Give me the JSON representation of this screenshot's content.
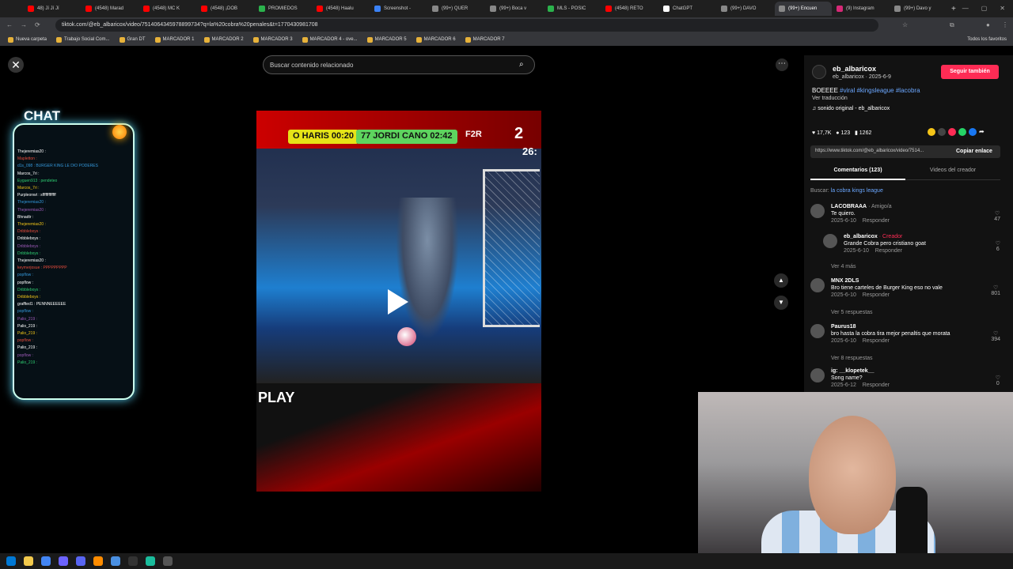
{
  "browser": {
    "tabs": [
      {
        "label": "48) Jí Jí Jí",
        "color": "#ff0000"
      },
      {
        "label": "(4548) Marad",
        "color": "#ff0000"
      },
      {
        "label": "(4548) MC K",
        "color": "#ff0000"
      },
      {
        "label": "(4548) ¡DOB",
        "color": "#ff0000"
      },
      {
        "label": "PROMIEDOS",
        "color": "#2bb24c"
      },
      {
        "label": "(4548) Haalu",
        "color": "#ff0000"
      },
      {
        "label": "Screenshot -",
        "color": "#3b82f6"
      },
      {
        "label": "(99+) QUER",
        "color": "#888888"
      },
      {
        "label": "(99+) Boca v",
        "color": "#888888"
      },
      {
        "label": "MLS - POSIC",
        "color": "#2bb24c"
      },
      {
        "label": "(4548) RETO",
        "color": "#ff0000"
      },
      {
        "label": "ChatGPT",
        "color": "#ffffff"
      },
      {
        "label": "(99+) DAVO",
        "color": "#888888"
      },
      {
        "label": "(99+) Encuen",
        "color": "#888888",
        "active": true
      },
      {
        "label": "(9) Instagram",
        "color": "#d62976"
      },
      {
        "label": "(99+) Davo y",
        "color": "#888888"
      }
    ],
    "new_tab": "+",
    "url": "tiktok.com/@eb_albaricox/video/7514064345978899734?q=la%20cobra%20penales&t=1770430981708",
    "bookmarks": [
      "Nueva carpeta",
      "Trabajo Social Com...",
      "Gran DT",
      "MARCADOR 1",
      "MARCADOR 2",
      "MARCADOR 3",
      "MARCADOR 4 - ove...",
      "MARCADOR 5",
      "MARCADOR 6",
      "MARCADOR 7"
    ],
    "all_favorites": "Todos los favoritos"
  },
  "search": {
    "placeholder": "Buscar contenido relacionado"
  },
  "video": {
    "score_left": "O HARIS 00:20",
    "score_mid": "77 JORDI CANO 02:42",
    "team": "F2R",
    "score_num": "2",
    "timer": "26:",
    "play_text": "PLAY"
  },
  "overlay_chat": {
    "title": "CHAT",
    "lines": [
      "Thejeremias20 :",
      "Mapletton :",
      "d1s_098 : BURGER KING LE DIO PODERES",
      "Marcos_7ri :",
      "Eyguen913 : pendeteo",
      "Marcos_7ri :",
      "Purpleonwt : sfffffffffffff",
      "Thejeremias20 :",
      "Thejeremias20 :",
      "Bhnadtr :",
      "Thejeremias20 :",
      "Dribbleboys :",
      "Dribbleboys :",
      "Dribbleboys :",
      "Dribbleboys :",
      "Thejeremias20 :",
      "keymerjosue : PPPPPPPPP",
      "popflow :",
      "popflow :",
      "Dribbleboys :",
      "Dribbleboys :",
      "graffted1 : PENNNEEEEEE",
      "popflow :",
      "Palio_219 :",
      "Palio_219 :",
      "Palio_219 :",
      "popflow :",
      "Palio_219 :",
      "popflow :",
      "Palio_219 :"
    ]
  },
  "post": {
    "author": "eb_albaricox",
    "handle_date": "eb_albaricox · 2025-6-9",
    "follow": "Seguir también",
    "caption": "BOEEEE",
    "hashtags": "#viral #kingsleague #lacobra",
    "translate": "Ver traducción",
    "sound": "sonido original - eb_albaricox",
    "likes": "17,7K",
    "comments_count": "123",
    "saves": "1262",
    "link": "https://www.tiktok.com/@eb_albaricox/video/7514...",
    "copy_link": "Copiar enlace",
    "tab_comments": "Comentarios (123)",
    "tab_creator": "Videos del creador",
    "search_label": "Buscar:",
    "search_term": "la cobra kings league"
  },
  "comments": [
    {
      "user": "LACOBRAAA",
      "tag": "· Amigo/a",
      "text": "Te quiero.",
      "date": "2025-6-10",
      "reply": "Responder",
      "likes": "47"
    },
    {
      "user": "eb_albaricox",
      "tag": "· Creador",
      "text": "Grande Cobra pero cristiano goat",
      "date": "2025-6-10",
      "reply": "Responder",
      "likes": "6"
    },
    {
      "user": "MNX 2DLS",
      "tag": "",
      "text": "Bro tiene carteles de Burger King eso no vale",
      "date": "2025-6-10",
      "reply": "Responder",
      "likes": "801"
    },
    {
      "user": "Paurus18",
      "tag": "",
      "text": "bro hasta la cobra tira mejor penaltis que morata",
      "date": "2025-6-10",
      "reply": "Responder",
      "likes": "394"
    },
    {
      "user": "ig: __klopetek__",
      "tag": "",
      "text": "Song name?",
      "date": "2025-6-12",
      "reply": "Responder",
      "likes": "0"
    }
  ],
  "see_more": [
    "Ver 4 más",
    "Ver 5 respuestas",
    "Ver 8 respuestas"
  ]
}
